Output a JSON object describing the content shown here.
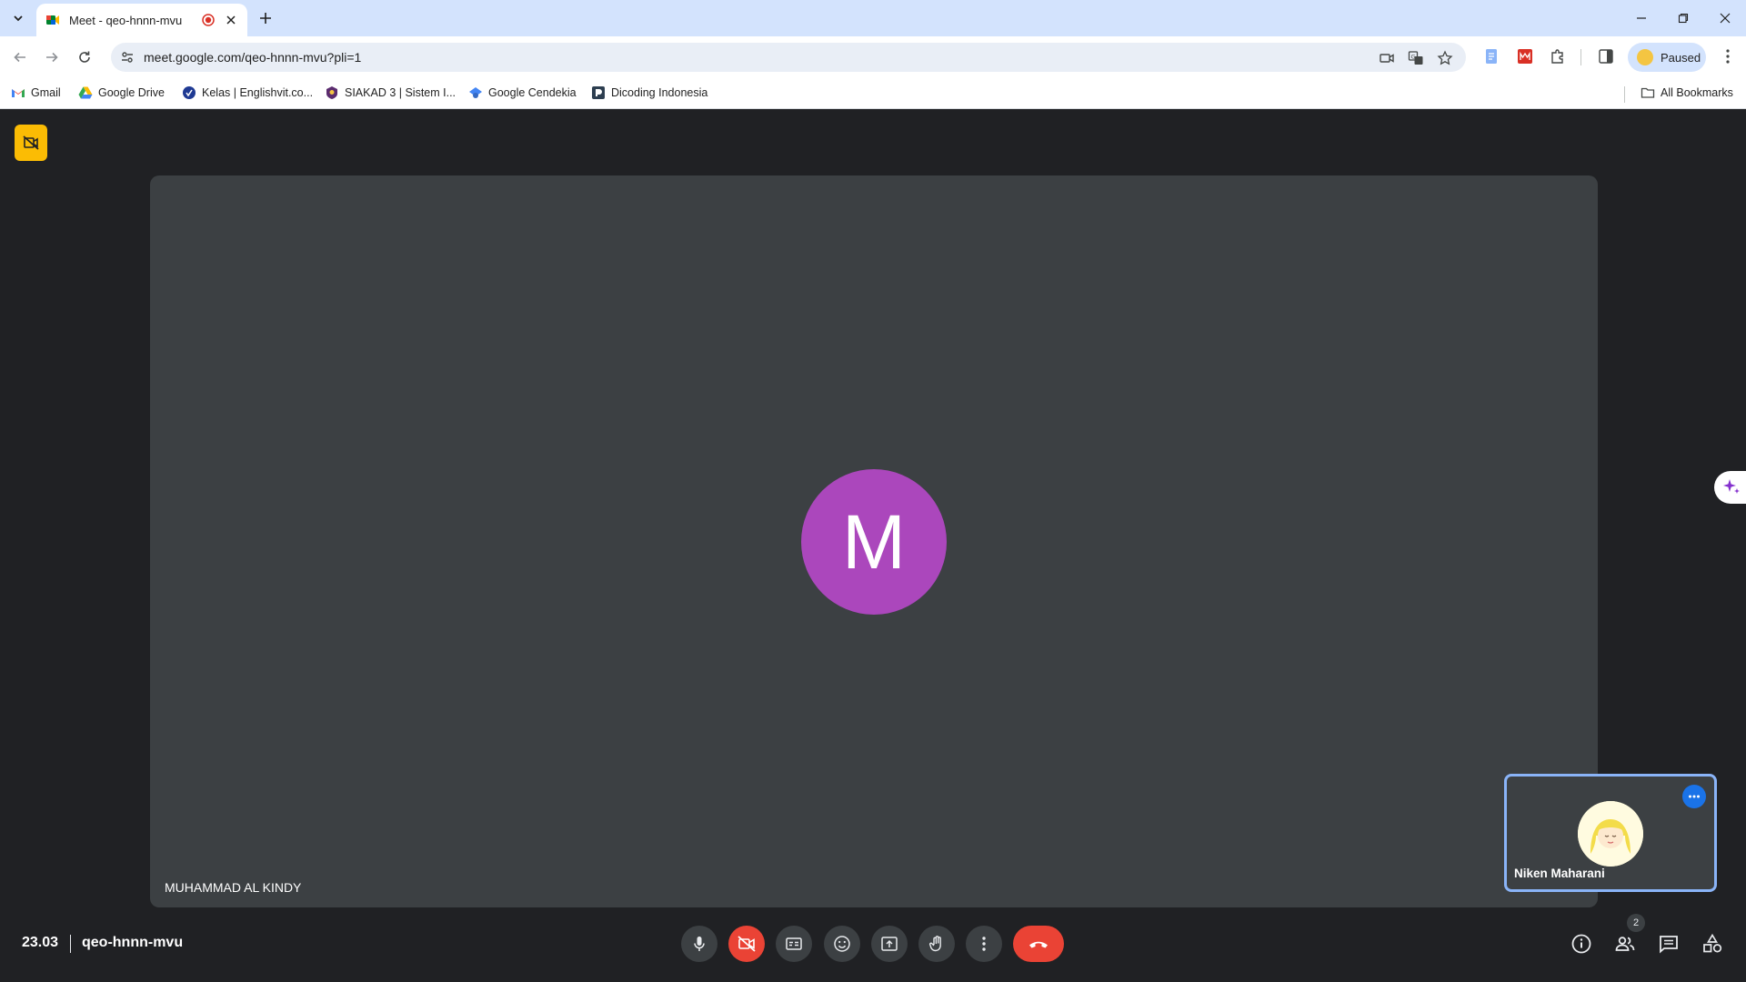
{
  "browser": {
    "tab": {
      "title": "Meet - qeo-hnnn-mvu"
    },
    "url": "meet.google.com/qeo-hnnn-mvu?pli=1",
    "profile_label": "Paused",
    "bookmarks": [
      {
        "label": "Gmail",
        "icon": "gmail-icon"
      },
      {
        "label": "Google Drive",
        "icon": "drive-icon"
      },
      {
        "label": "Kelas | Englishvit.co...",
        "icon": "englishvit-icon"
      },
      {
        "label": "SIAKAD 3 | Sistem I...",
        "icon": "siakad-icon"
      },
      {
        "label": "Google Cendekia",
        "icon": "scholar-icon"
      },
      {
        "label": "Dicoding Indonesia",
        "icon": "dicoding-icon"
      }
    ],
    "all_bookmarks_label": "All Bookmarks"
  },
  "meet": {
    "main_tile": {
      "initial": "M",
      "name": "MUHAMMAD AL KINDY",
      "avatar_color": "#ab47bc"
    },
    "self_tile": {
      "name": "Niken Maharani"
    },
    "time": "23.03",
    "meeting_code": "qeo-hnnn-mvu",
    "participant_count": "2",
    "colors": {
      "accent": "#8ab4f8",
      "hangup": "#ea4335",
      "warning": "#fbbc04",
      "background": "#202124",
      "tile": "#3c4043"
    }
  }
}
